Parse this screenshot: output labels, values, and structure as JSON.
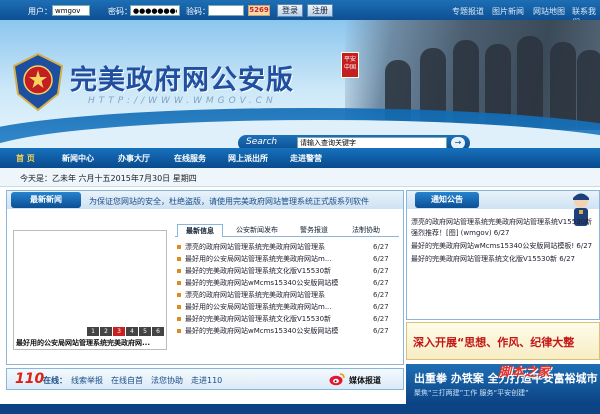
{
  "topbar": {
    "username_label": "用户：",
    "username_value": "wmgov",
    "password_label": "密码：",
    "password_value": "●●●●●●●●",
    "captcha_label": "验码：",
    "captcha_value": "",
    "captcha_code": "5269",
    "login_button": "登录",
    "register_button": "注册",
    "links": [
      "专题报道",
      "图片新闻",
      "网站地图",
      "联系我们"
    ]
  },
  "banner": {
    "site_title": "完美政府网公安版",
    "site_url": "HTTP://WWW.WMGOV.CN",
    "badge_text": "平安中国",
    "search_label": "Search",
    "search_placeholder": "请输入查询关键字",
    "search_go": "→"
  },
  "nav": {
    "items": [
      "首 页",
      "新闻中心",
      "办事大厅",
      "在线服务",
      "网上派出所",
      "走进警营"
    ]
  },
  "datebar": {
    "date_text": "今天是：乙未年 六月十五2015年7月30日 星期四",
    "marquee": "为保证您网站的安全，杜绝盗版，请使用完美政府网站管理系统正式版系列软件"
  },
  "latest_news": {
    "title": "最新新闻",
    "photo_caption": "最好用的公安局网站管理系统完美政府网...",
    "photo_pages": [
      "1",
      "2",
      "3",
      "4",
      "5",
      "6"
    ],
    "tabs": [
      "最新信息",
      "公安新闻发布",
      "警务报道",
      "法制协助"
    ],
    "items": [
      {
        "title": "漂亮的政府网站管理系统完美政府网站管理系",
        "date": "6/27"
      },
      {
        "title": "最好用的公安局网站管理系统完美政府网站m...",
        "date": "6/27"
      },
      {
        "title": "最好的完美政府网站管理系统文化版V15530新",
        "date": "6/27"
      },
      {
        "title": "最好的完美政府网站wMcms15340公安版网站模",
        "date": "6/27"
      },
      {
        "title": "漂亮的政府网站管理系统完美政府网站管理系",
        "date": "6/27"
      },
      {
        "title": "最好用的公安局网站管理系统完美政府网站m...",
        "date": "6/27"
      },
      {
        "title": "最好的完美政府网站管理系统文化版V15530新",
        "date": "6/27"
      },
      {
        "title": "最好的完美政府网站wMcms15340公安版网站模",
        "date": "6/27"
      }
    ]
  },
  "notice": {
    "title": "通知公告",
    "items": [
      "漂亮的政府网站管理系统完美政府网站管理系统V15530新强烈推荐！[图] (wmgov)    6/27",
      "最好的完美政府网站wMcms15340公安版网站模板!    6/27",
      "最好的完美政府网站管理系统文化版V15530新    6/27"
    ]
  },
  "slogan": {
    "text": "深入开展“思想、作风、纪律大整"
  },
  "bottom": {
    "number": "110",
    "online_label": "在线：",
    "links": [
      "线索举报",
      "在线自首",
      "法您协助",
      "走进110"
    ],
    "weibo_label": "媒体报道"
  },
  "right_banner": {
    "big": "出重拳 办铁案 全力打造平安富裕城市",
    "sub": "聚焦“三打两建”工作  服务“平安创建”"
  },
  "watermark": "脚本之家",
  "colors": {
    "primary_blue": "#0e4f93",
    "accent_red": "#c21e23",
    "nav_active": "#ffd34d"
  }
}
